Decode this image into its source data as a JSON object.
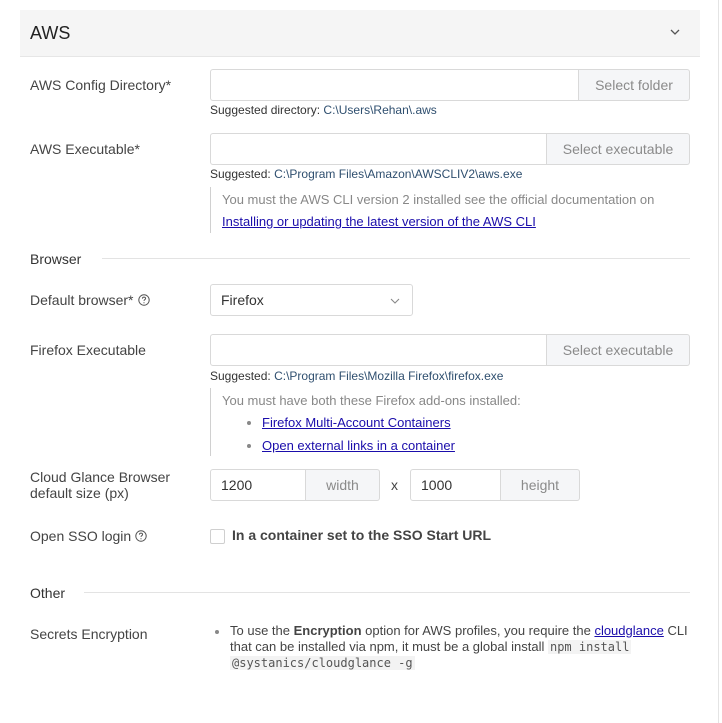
{
  "panel": {
    "title": "AWS"
  },
  "aws": {
    "config_dir": {
      "label": "AWS Config Directory*",
      "value": "",
      "button": "Select folder",
      "suggest_prefix": "Suggested directory:",
      "suggest_path": "C:\\Users\\Rehan\\.aws"
    },
    "executable": {
      "label": "AWS Executable*",
      "value": "",
      "button": "Select executable",
      "suggest_prefix": "Suggested:",
      "suggest_path": "C:\\Program Files\\Amazon\\AWSCLIV2\\aws.exe",
      "note": "You must the AWS CLI version 2 installed see the official documentation on",
      "link": "Installing or updating the latest version of the AWS CLI"
    }
  },
  "browser": {
    "section_title": "Browser",
    "default_browser": {
      "label": "Default browser*",
      "value": "Firefox"
    },
    "firefox_exe": {
      "label": "Firefox Executable",
      "value": "",
      "button": "Select executable",
      "suggest_prefix": "Suggested:",
      "suggest_path": "C:\\Program Files\\Mozilla Firefox\\firefox.exe",
      "note": "You must have both these Firefox add-ons installed:",
      "addons": [
        "Firefox Multi-Account Containers",
        "Open external links in a container"
      ]
    },
    "size": {
      "label_line1": "Cloud Glance Browser",
      "label_line2": "default size (px)",
      "width_value": "1200",
      "width_addon": "width",
      "separator": "x",
      "height_value": "1000",
      "height_addon": "height"
    },
    "sso": {
      "label": "Open SSO login",
      "checkbox_label": "In a container set to the SSO Start URL",
      "checked": false
    }
  },
  "other": {
    "section_title": "Other",
    "secrets": {
      "label": "Secrets Encryption",
      "t1": "To use the ",
      "bold": "Encryption",
      "t2": " option for AWS profiles, you require the ",
      "link": "cloudglance",
      "t3": " CLI",
      "t4": "that can be installed via npm, it must be a global install ",
      "code1": "npm install",
      "code2": "@systanics/cloudglance -g"
    }
  }
}
